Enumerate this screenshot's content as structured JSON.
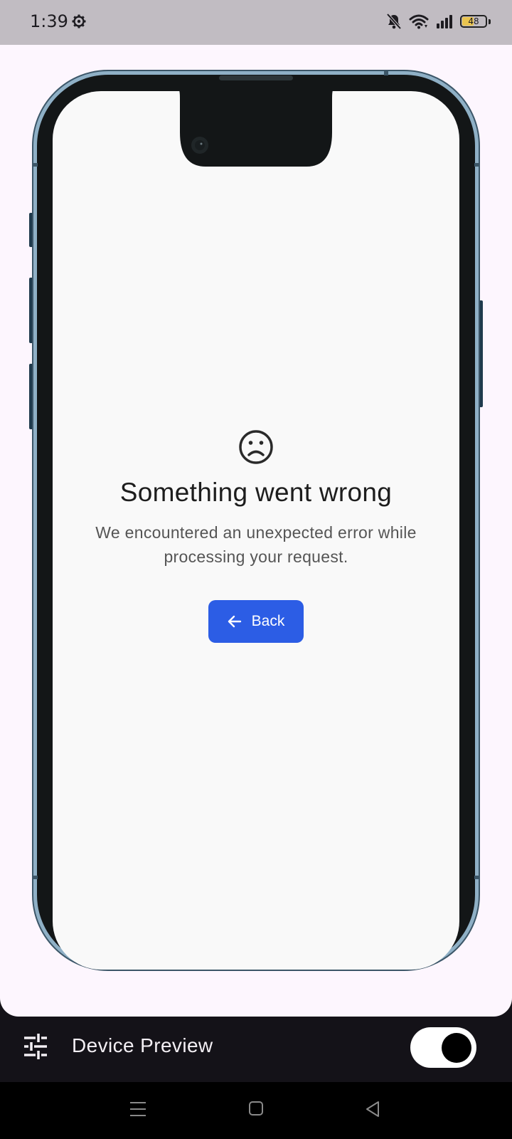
{
  "status_bar": {
    "time": "1:39",
    "battery_level": "48",
    "icons": [
      "settings-gear-icon",
      "notifications-muted-icon",
      "wifi-icon",
      "cellular-signal-icon",
      "battery-icon"
    ]
  },
  "error_screen": {
    "icon": "sad-face-icon",
    "title": "Something went wrong",
    "message": "We encountered an unexpected error while processing your request.",
    "back_button": {
      "label": "Back",
      "icon": "arrow-left-icon"
    }
  },
  "bottom_bar": {
    "label": "Device Preview",
    "settings_icon": "tune-icon",
    "toggle_on": true
  },
  "nav_bar": {
    "items": [
      "menu-nav-icon",
      "home-nav-icon",
      "back-nav-icon"
    ]
  },
  "colors": {
    "accent": "#2c5de5",
    "phone_frame": "#8fb0c6",
    "battery_fill": "#e9c44f"
  }
}
